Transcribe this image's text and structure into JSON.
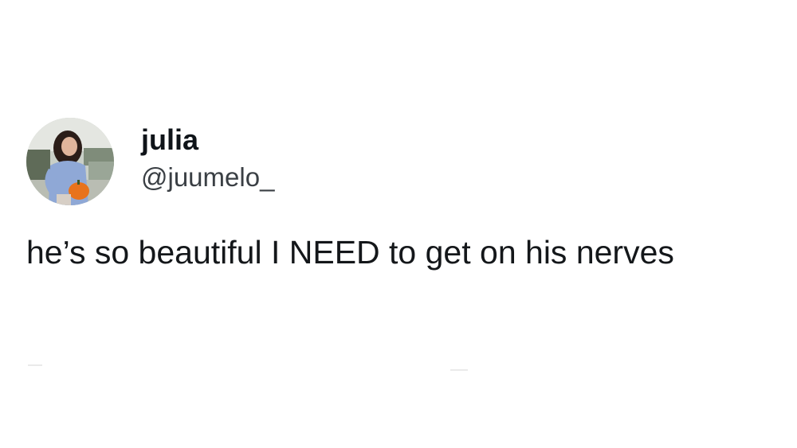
{
  "tweet": {
    "author": {
      "display_name": "julia",
      "handle": "@juumelo_",
      "avatar_icon": "profile-photo-avatar"
    },
    "text": "he’s so beautiful I NEED to get on his nerves"
  },
  "colors": {
    "background": "#ffffff",
    "text_primary": "#0f1419",
    "text_secondary": "#3a3f44"
  }
}
